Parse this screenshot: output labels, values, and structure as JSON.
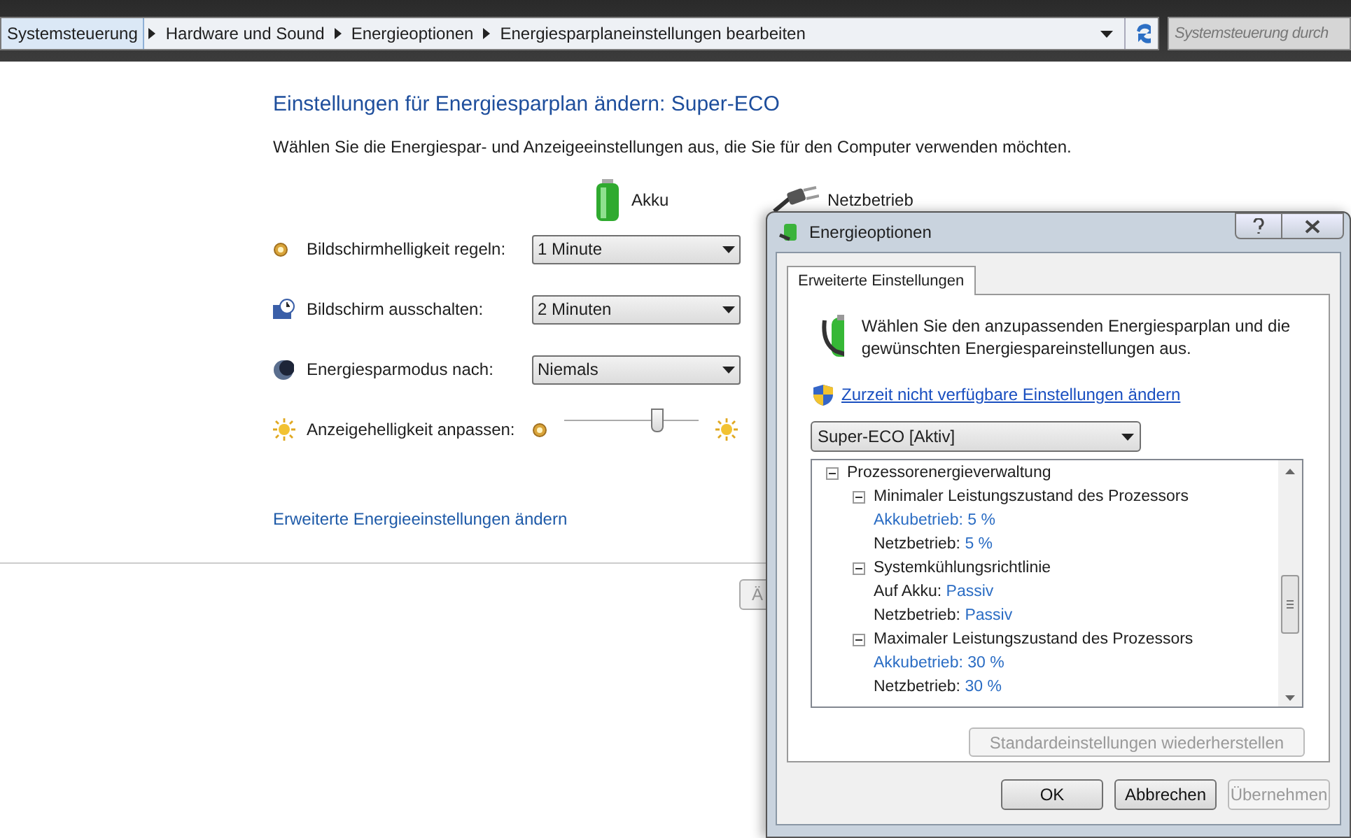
{
  "address_bar": {
    "crumbs": [
      {
        "label": "Systemsteuerung",
        "selected": true
      },
      {
        "label": "Hardware und Sound",
        "selected": false
      },
      {
        "label": "Energieoptionen",
        "selected": false
      },
      {
        "label": "Energiesparplaneinstellungen bearbeiten",
        "selected": false
      }
    ],
    "search_placeholder": "Systemsteuerung durch"
  },
  "title": "Einstellungen für Energiesparplan ändern: Super-ECO",
  "subtitle": "Wählen Sie die Energiespar- und Anzeigeeinstellungen aus, die Sie für den Computer verwenden möchten.",
  "columns": [
    "Akku",
    "Netzbetrieb"
  ],
  "settings": [
    {
      "kind": "select",
      "label": "Bildschirmhelligkeit regeln:",
      "value": "1 Minute"
    },
    {
      "kind": "select",
      "label": "Bildschirm ausschalten:",
      "value": "2 Minuten"
    },
    {
      "kind": "select",
      "label": "Energiesparmodus nach:",
      "value": "Niemals"
    },
    {
      "kind": "slider",
      "label": "Anzeigehelligkeit anpassen:",
      "level": 0.69
    }
  ],
  "advanced_link": "Erweiterte Energieeinstellungen ändern",
  "save_button": "Ä",
  "dialog": {
    "title": "Energieoptionen",
    "tab": {
      "label": "Erweiterte Einstellungen",
      "selected": true
    },
    "intro": "Wählen Sie den anzupassenden Energiesparplan und die gewünschten Energiespareinstellungen aus.",
    "admin_link": "Zurzeit nicht verfügbare Einstellungen ändern",
    "plan": "Super-ECO [Aktiv]",
    "tree": [
      {
        "label": "Prozessorenergieverwaltung",
        "expanded": true,
        "children": [
          {
            "label": "Minimaler Leistungszustand des Prozessors",
            "expanded": true,
            "children": [
              {
                "label": "Akkubetrieb:",
                "value": "5 %",
                "selected": true
              },
              {
                "label": "Netzbetrieb:",
                "value": "5 %",
                "selected": false
              }
            ]
          },
          {
            "label": "Systemkühlungsrichtlinie",
            "expanded": true,
            "children": [
              {
                "label": "Auf Akku:",
                "value": "Passiv",
                "selected": false
              },
              {
                "label": "Netzbetrieb:",
                "value": "Passiv",
                "selected": false
              }
            ]
          },
          {
            "label": "Maximaler Leistungszustand des Prozessors",
            "expanded": true,
            "children": [
              {
                "label": "Akkubetrieb:",
                "value": "30 %",
                "selected": true
              },
              {
                "label": "Netzbetrieb:",
                "value": "30 %",
                "selected": false
              }
            ]
          }
        ]
      }
    ],
    "restore_button": {
      "label": "Standardeinstellungen wiederherstellen",
      "disabled": true
    },
    "buttons": [
      {
        "label": "OK",
        "disabled": false
      },
      {
        "label": "Abbrechen",
        "disabled": false
      },
      {
        "label": "Übernehmen",
        "disabled": true
      }
    ]
  }
}
